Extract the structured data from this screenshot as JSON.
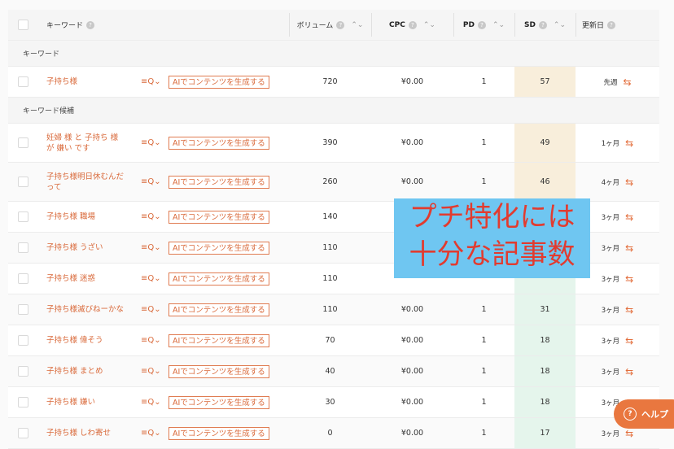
{
  "header": {
    "keyword": "キーワード",
    "volume": "ボリューム",
    "cpc": "CPC",
    "pd": "PD",
    "sd": "SD",
    "updated": "更新日"
  },
  "sections": {
    "keyword": "キーワード",
    "candidates": "キーワード候補"
  },
  "ai_button_label": "AIでコンテンツを生成する",
  "main_row": {
    "keyword": "子持ち様",
    "volume": "720",
    "cpc": "¥0.00",
    "pd": "1",
    "sd": "57",
    "updated": "先週"
  },
  "rows": [
    {
      "kw1": "妊婦 様 と 子持ち 様",
      "kw2": "が 嫌い です",
      "volume": "390",
      "cpc": "¥0.00",
      "pd": "1",
      "sd": "49",
      "updated": "1ヶ月"
    },
    {
      "kw1": "子持ち様明日休むんだ",
      "kw2": "って",
      "volume": "260",
      "cpc": "¥0.00",
      "pd": "1",
      "sd": "46",
      "updated": "4ヶ月"
    },
    {
      "kw1": "子持ち様 職場",
      "kw2": "",
      "volume": "140",
      "cpc": "",
      "pd": "",
      "sd": "",
      "updated": "3ヶ月"
    },
    {
      "kw1": "子持ち様 うざい",
      "kw2": "",
      "volume": "110",
      "cpc": "",
      "pd": "",
      "sd": "",
      "updated": "3ヶ月"
    },
    {
      "kw1": "子持ち様 迷惑",
      "kw2": "",
      "volume": "110",
      "cpc": "",
      "pd": "",
      "sd": "",
      "updated": "3ヶ月"
    },
    {
      "kw1": "子持ち様滅びねーかな",
      "kw2": "",
      "volume": "110",
      "cpc": "¥0.00",
      "pd": "1",
      "sd": "31",
      "updated": "3ヶ月"
    },
    {
      "kw1": "子持ち様 偉そう",
      "kw2": "",
      "volume": "70",
      "cpc": "¥0.00",
      "pd": "1",
      "sd": "18",
      "updated": "3ヶ月"
    },
    {
      "kw1": "子持ち様 まとめ",
      "kw2": "",
      "volume": "40",
      "cpc": "¥0.00",
      "pd": "1",
      "sd": "18",
      "updated": "3ヶ月"
    },
    {
      "kw1": "子持ち様 嫌い",
      "kw2": "",
      "volume": "30",
      "cpc": "¥0.00",
      "pd": "1",
      "sd": "18",
      "updated": "3ヶ月"
    },
    {
      "kw1": "子持ち様 しわ寄せ",
      "kw2": "",
      "volume": "0",
      "cpc": "¥0.00",
      "pd": "1",
      "sd": "17",
      "updated": "3ヶ月"
    }
  ],
  "overlay": {
    "line1": "プチ特化には",
    "line2": "十分な記事数"
  },
  "help_label": "ヘルプ",
  "colors": {
    "accent": "#d9693a",
    "sd_orange": "#f8eedb",
    "sd_green": "#e5f5ec",
    "overlay_bg": "#6fc6f1",
    "overlay_text": "#e23b2f"
  },
  "icons": {
    "tool": "search-list-icon",
    "refresh": "refresh-icon",
    "help": "question-circle-icon"
  }
}
